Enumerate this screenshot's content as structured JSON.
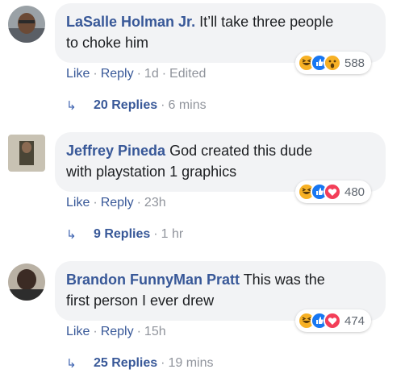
{
  "comments": [
    {
      "author": "LaSalle Holman Jr.",
      "text": "It’ll take three people to choke him",
      "line1_text": "It’ll take three people",
      "line2_text": "to choke him",
      "reaction_icons": [
        "haha-icon",
        "like-icon",
        "wow-icon"
      ],
      "reaction_count": "588",
      "like_label": "Like",
      "reply_label": "Reply",
      "time": "1d",
      "edited_label": "Edited",
      "replies_label": "20 Replies",
      "replies_time": "6 mins"
    },
    {
      "author": "Jeffrey Pineda",
      "text": "God created this dude with playstation 1 graphics",
      "line1_text": "God created this dude",
      "line2_text": "with playstation 1 graphics",
      "reaction_icons": [
        "haha-icon",
        "like-icon",
        "love-icon"
      ],
      "reaction_count": "480",
      "like_label": "Like",
      "reply_label": "Reply",
      "time": "23h",
      "replies_label": "9 Replies",
      "replies_time": "1 hr"
    },
    {
      "author": "Brandon FunnyMan Pratt",
      "text": "This was the first person I ever drew",
      "line1_text": "This was the",
      "line2_text": "first person I ever drew",
      "reaction_icons": [
        "haha-icon",
        "like-icon",
        "love-icon"
      ],
      "reaction_count": "474",
      "like_label": "Like",
      "reply_label": "Reply",
      "time": "15h",
      "replies_label": "25 Replies",
      "replies_time": "19 mins"
    }
  ],
  "colors": {
    "link_blue": "#385898",
    "bubble_bg": "#f2f3f5",
    "meta_gray": "#90949c"
  }
}
